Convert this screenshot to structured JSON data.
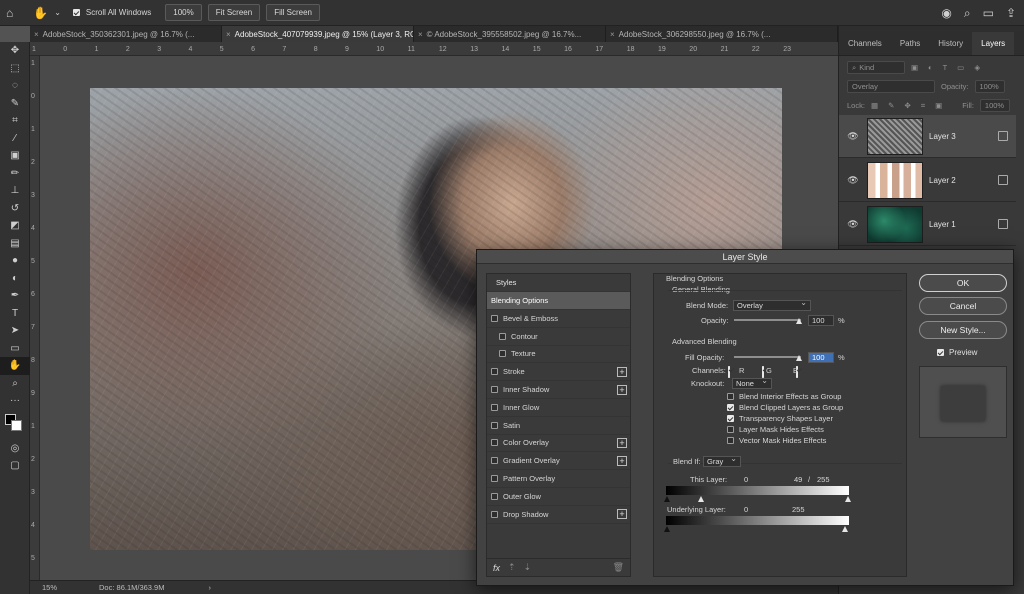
{
  "options": {
    "scroll_all_label": "Scroll All Windows",
    "zoom_100": "100%",
    "fit_screen": "Fit Screen",
    "fill_screen": "Fill Screen"
  },
  "tabs": [
    {
      "label": "AdobeStock_350362301.jpeg @ 16.7% (..."
    },
    {
      "label": "AdobeStock_407079939.jpeg @ 15% (Layer 3, RGB/8*) *"
    },
    {
      "label": "© AdobeStock_395558502.jpeg @ 16.7%..."
    },
    {
      "label": "AdobeStock_306298550.jpeg @ 16.7% (..."
    }
  ],
  "ruler_top": [
    "1",
    "0",
    "1",
    "2",
    "3",
    "4",
    "5",
    "6",
    "7",
    "8",
    "9",
    "10",
    "11",
    "12",
    "13",
    "14",
    "15",
    "16",
    "17",
    "18",
    "19",
    "20",
    "21",
    "22",
    "23"
  ],
  "ruler_left": [
    "1",
    "0",
    "1",
    "2",
    "3",
    "4",
    "5",
    "6",
    "7",
    "8",
    "9",
    "1",
    "2",
    "3",
    "4",
    "5"
  ],
  "status": {
    "zoom": "15%",
    "doc": "Doc: 86.1M/363.9M",
    "arrow": "›"
  },
  "panel": {
    "tabs": [
      "Channels",
      "Paths",
      "History",
      "Layers"
    ],
    "active_tab": 3,
    "kind_placeholder": "Kind",
    "blend_mode": "Overlay",
    "opacity_label": "Opacity:",
    "opacity_value": "100%",
    "lock_label": "Lock:",
    "fill_label": "Fill:",
    "fill_value": "100%",
    "layers": [
      {
        "name": "Layer 3",
        "selected": true
      },
      {
        "name": "Layer 2",
        "selected": false
      },
      {
        "name": "Layer 1",
        "selected": false
      }
    ]
  },
  "dialog": {
    "title": "Layer Style",
    "styles_header": "Styles",
    "blending_options": "Blending Options",
    "styles": [
      {
        "label": "Bevel & Emboss",
        "indent": 0,
        "plus": false
      },
      {
        "label": "Contour",
        "indent": 1,
        "plus": false
      },
      {
        "label": "Texture",
        "indent": 1,
        "plus": false
      },
      {
        "label": "Stroke",
        "indent": 0,
        "plus": true
      },
      {
        "label": "Inner Shadow",
        "indent": 0,
        "plus": true
      },
      {
        "label": "Inner Glow",
        "indent": 0,
        "plus": false
      },
      {
        "label": "Satin",
        "indent": 0,
        "plus": false
      },
      {
        "label": "Color Overlay",
        "indent": 0,
        "plus": true
      },
      {
        "label": "Gradient Overlay",
        "indent": 0,
        "plus": true
      },
      {
        "label": "Pattern Overlay",
        "indent": 0,
        "plus": false
      },
      {
        "label": "Outer Glow",
        "indent": 0,
        "plus": false
      },
      {
        "label": "Drop Shadow",
        "indent": 0,
        "plus": true
      }
    ],
    "fx_label": "fx",
    "blending_title": "Blending Options",
    "general_title": "General Blending",
    "blend_mode_label": "Blend Mode:",
    "blend_mode_value": "Overlay",
    "opacity_label": "Opacity:",
    "opacity_value": "100",
    "percent": "%",
    "advanced_title": "Advanced Blending",
    "fill_opacity_label": "Fill Opacity:",
    "fill_opacity_value": "100",
    "channels_label": "Channels:",
    "channel_r": "R",
    "channel_g": "G",
    "channel_b": "B",
    "knockout_label": "Knockout:",
    "knockout_value": "None",
    "options": [
      {
        "label": "Blend Interior Effects as Group",
        "checked": false
      },
      {
        "label": "Blend Clipped Layers as Group",
        "checked": true
      },
      {
        "label": "Transparency Shapes Layer",
        "checked": true
      },
      {
        "label": "Layer Mask Hides Effects",
        "checked": false
      },
      {
        "label": "Vector Mask Hides Effects",
        "checked": false
      }
    ],
    "blend_if_label": "Blend If:",
    "blend_if_value": "Gray",
    "this_layer_label": "This Layer:",
    "this_layer_low": "0",
    "this_layer_mid": "49",
    "this_layer_slash": "/",
    "this_layer_high": "255",
    "this_layer_split_fraction": 0.19,
    "underlying_label": "Underlying Layer:",
    "underlying_low": "0",
    "underlying_high": "255",
    "ok": "OK",
    "cancel": "Cancel",
    "new_style": "New Style...",
    "preview_label": "Preview"
  }
}
